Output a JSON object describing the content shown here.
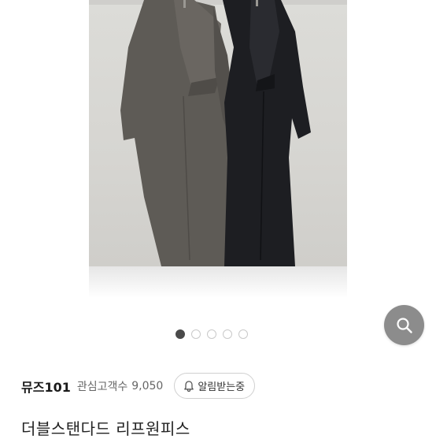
{
  "gallery": {
    "image_count": 5,
    "active_index": 0
  },
  "seller": {
    "name": "뮤즈101",
    "follower_label": "관심고객수",
    "follower_count": "9,050",
    "notify_label": "알림받는중"
  },
  "product": {
    "title": "더블스탠다드 리프원피스"
  },
  "colors": {
    "search_fab_bg": "#8c8c8c",
    "dot_active": "#4a4a4a",
    "dot_inactive_border": "#c9c9c9"
  },
  "icons": {
    "search_fab": "search-icon",
    "notify": "bell-icon"
  }
}
